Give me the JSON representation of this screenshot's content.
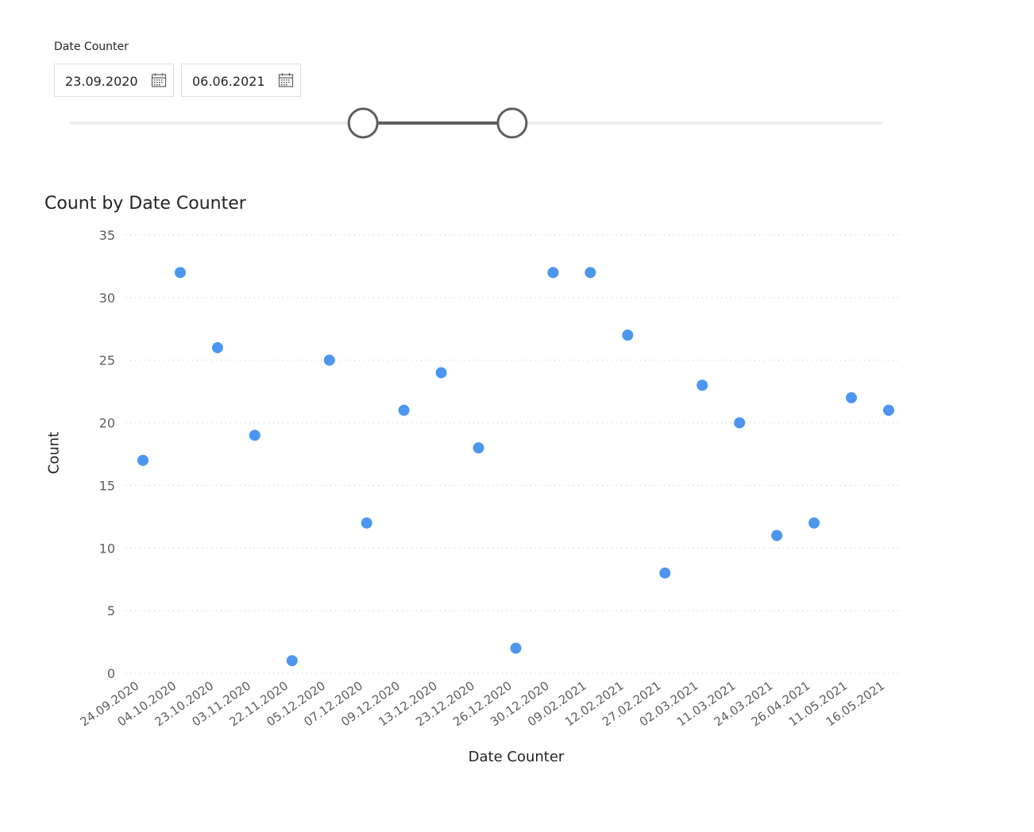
{
  "slicer": {
    "title": "Date Counter",
    "start_date": "23.09.2020",
    "end_date": "06.06.2021",
    "start_icon": "calendar-icon",
    "end_icon": "calendar-icon",
    "range_start_fraction": 0.36,
    "range_end_fraction": 0.544
  },
  "chart": {
    "title": "Count by Date Counter",
    "x_axis_title": "Date Counter",
    "y_axis_title": "Count"
  },
  "colors": {
    "marker": "#4c96ef",
    "gridline": "#c8c6c4",
    "tick_text": "#605e5c",
    "slider_track": "#eeeeee",
    "slider_active": "#605e5c"
  },
  "chart_data": {
    "type": "scatter",
    "title": "Count by Date Counter",
    "xlabel": "Date Counter",
    "ylabel": "Count",
    "ylim": [
      0,
      35
    ],
    "yticks": [
      0,
      5,
      10,
      15,
      20,
      25,
      30,
      35
    ],
    "grid": true,
    "categories": [
      "24.09.2020",
      "04.10.2020",
      "23.10.2020",
      "03.11.2020",
      "22.11.2020",
      "05.12.2020",
      "07.12.2020",
      "09.12.2020",
      "13.12.2020",
      "23.12.2020",
      "26.12.2020",
      "30.12.2020",
      "09.02.2021",
      "12.02.2021",
      "27.02.2021",
      "02.03.2021",
      "11.03.2021",
      "24.03.2021",
      "26.04.2021",
      "11.05.2021",
      "16.05.2021"
    ],
    "values": [
      17,
      32,
      26,
      19,
      1,
      25,
      12,
      21,
      24,
      18,
      2,
      32,
      32,
      27,
      8,
      23,
      20,
      11,
      12,
      22,
      21
    ]
  }
}
